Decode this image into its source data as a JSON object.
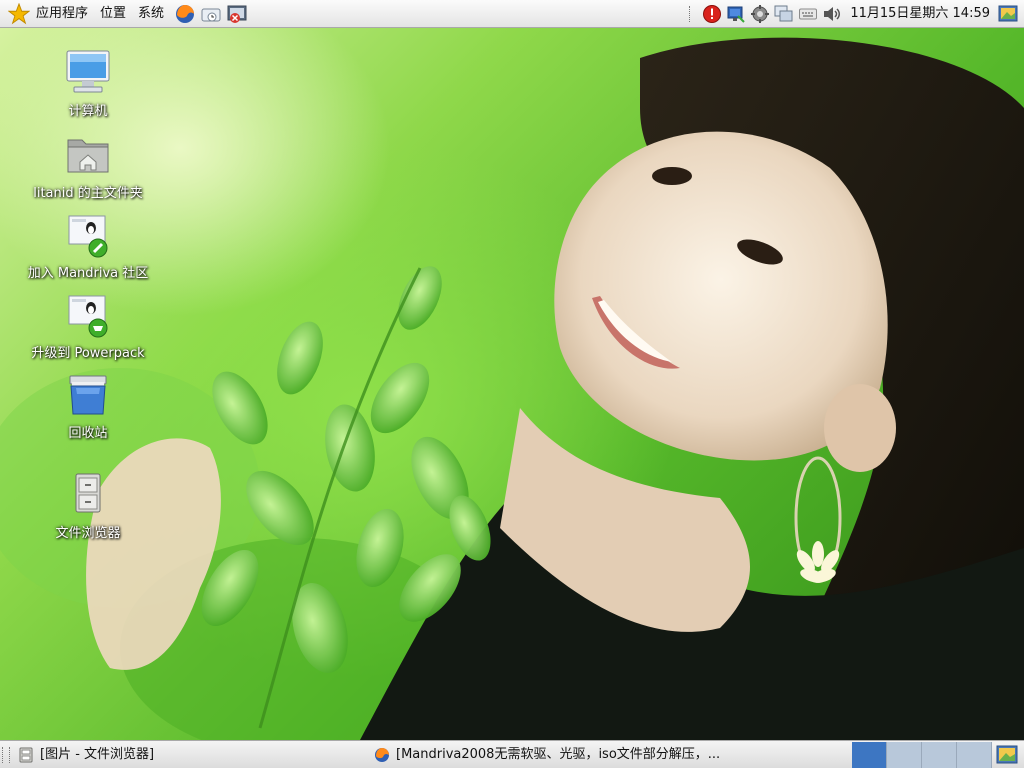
{
  "top_panel": {
    "menus": [
      "应用程序",
      "位置",
      "系统"
    ],
    "launchers": [
      "firefox-icon",
      "mail-icon",
      "terminal-icon"
    ],
    "tray_icons": [
      "alert-icon",
      "network-icon",
      "update-icon",
      "computer-icon",
      "keyboard-icon",
      "volume-icon"
    ],
    "clock": "11月15日星期六 14:59"
  },
  "desktop": {
    "icons": [
      {
        "label": "计算机",
        "icon": "computer-icon"
      },
      {
        "label": "litanid 的主文件夹",
        "icon": "home-folder-icon"
      },
      {
        "label": "加入 Mandriva 社区",
        "icon": "mandriva-join-icon"
      },
      {
        "label": "升级到 Powerpack",
        "icon": "powerpack-upgrade-icon"
      },
      {
        "label": "回收站",
        "icon": "trash-icon"
      },
      {
        "label": "文件浏览器",
        "icon": "file-browser-icon"
      }
    ]
  },
  "bottom_panel": {
    "tasks": [
      {
        "label": "[图片 - 文件浏览器]",
        "icon": "file-manager-icon"
      },
      {
        "label": "[Mandriva2008无需软驱、光驱，iso文件部分解压，...",
        "icon": "firefox-icon"
      }
    ],
    "workspaces": 4,
    "active_workspace": 1
  },
  "colors": {
    "accent": "#3d76c2",
    "wallpaper_green": "#6fc23a"
  }
}
